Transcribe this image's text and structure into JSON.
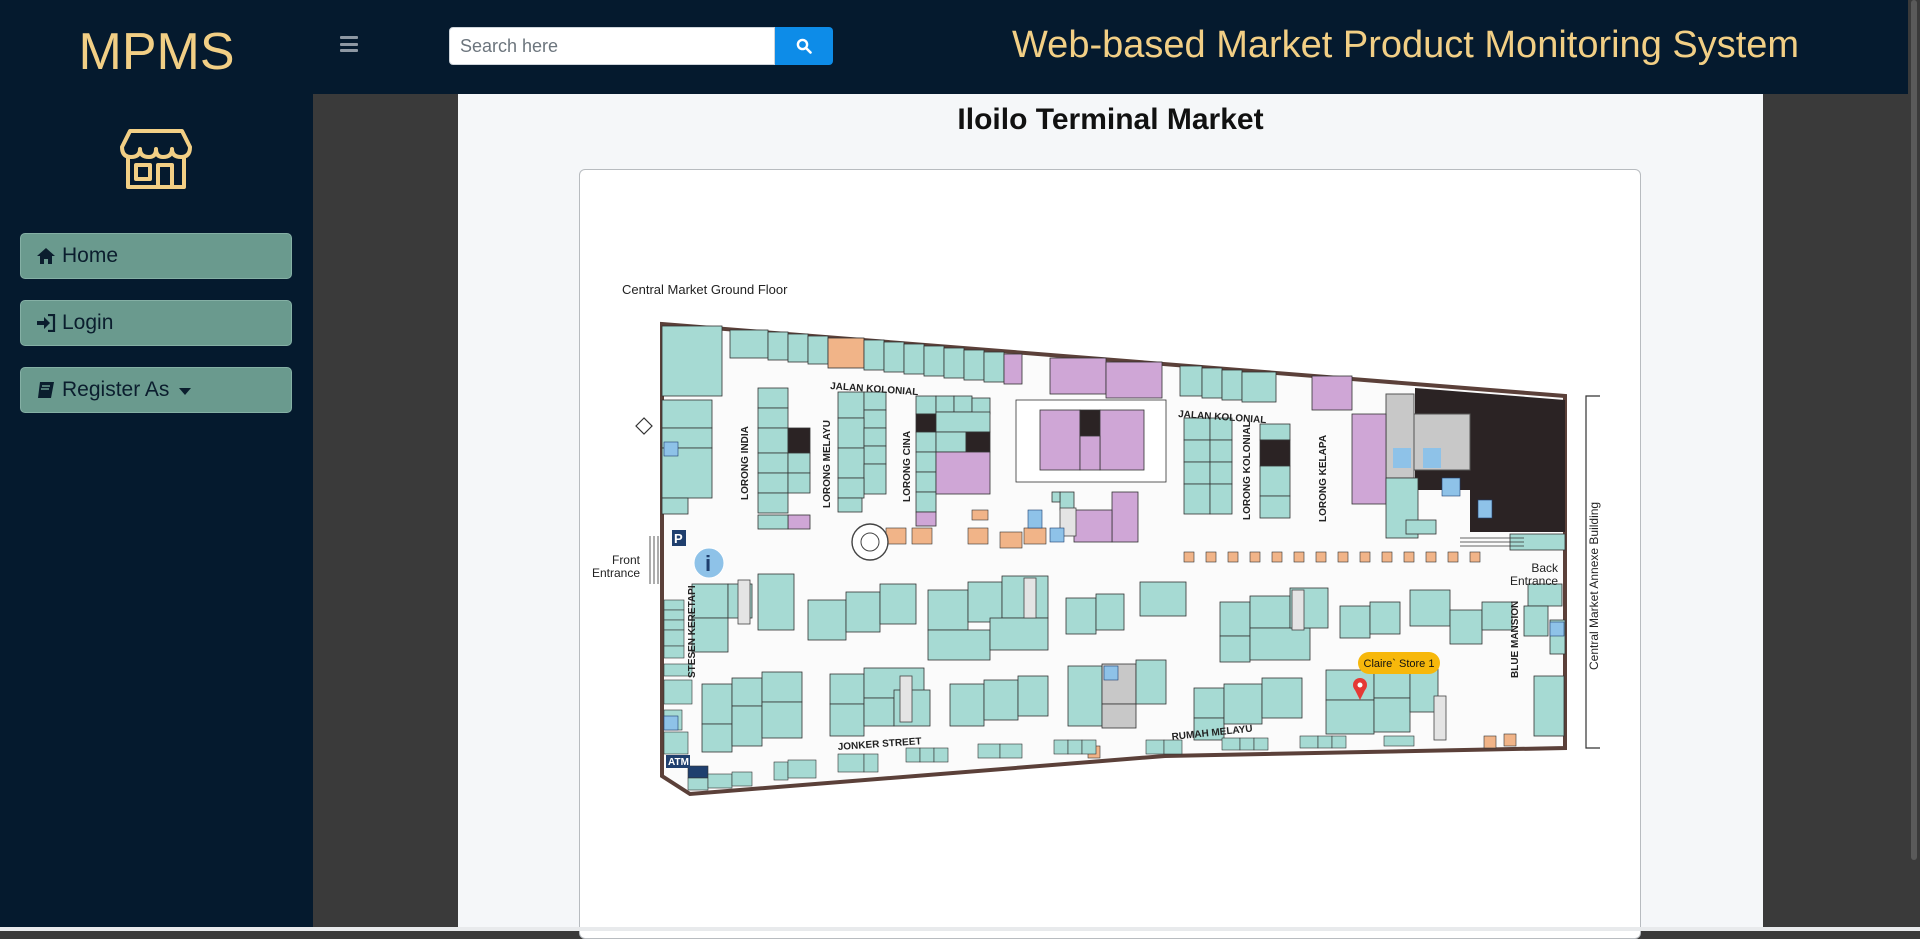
{
  "sidebar": {
    "brand": "MPMS",
    "logo_icon": "store-icon",
    "nav": [
      {
        "label": "Home",
        "icon": "home-icon"
      },
      {
        "label": "Login",
        "icon": "sign-in-icon"
      },
      {
        "label": "Register As",
        "icon": "book-icon",
        "dropdown": true
      }
    ]
  },
  "header": {
    "menu_icon": "hamburger-icon",
    "search_placeholder": "Search here",
    "search_icon": "search-icon",
    "title": "Web-based Market Product Monitoring System"
  },
  "main": {
    "title": "Iloilo Terminal Market",
    "map": {
      "floor_label": "Central Market Ground Floor",
      "front_entrance": [
        "Front",
        "Entrance"
      ],
      "back_entrance": [
        "Back",
        "Entrance"
      ],
      "annexe_label": "Central Market Annexe Building",
      "marker_label": "Claire` Store 1",
      "streets": [
        "JALAN KOLONIAL",
        "JALAN KOLONIAL",
        "LORONG INDIA",
        "LORONG MELAYU",
        "LORONG CINA",
        "LORONG KOLONIAL",
        "LORONG KELAPA",
        "STESEN KERETAPI",
        "JONKER STREET",
        "RUMAH MELAYU",
        "BLUE MANSION"
      ],
      "atm_label": "ATM",
      "parking_label": "P",
      "info_label": "i"
    }
  },
  "colors": {
    "sidebar_bg": "#051a2e",
    "accent_gold": "#f2cf85",
    "nav_button": "#6a9a8e",
    "search_button": "#0d8ce8",
    "stall_teal": "#a6dad3",
    "stall_purple": "#cfa6d6",
    "marker_bg": "#f7b80b"
  }
}
